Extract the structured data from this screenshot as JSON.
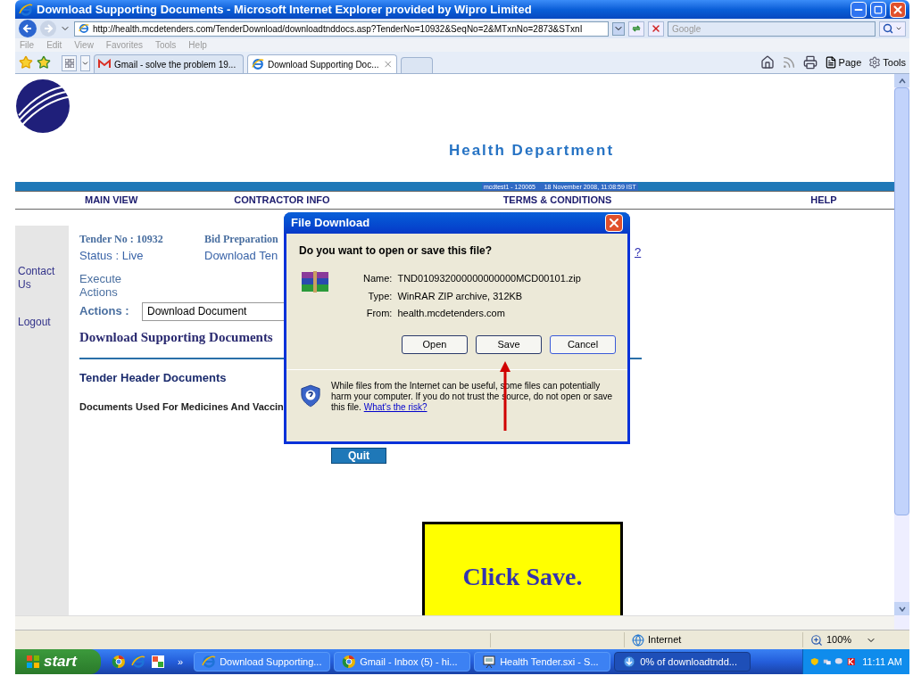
{
  "window": {
    "title": "Download Supporting Documents - Microsoft Internet Explorer provided by Wipro Limited"
  },
  "address_bar": {
    "url": "http://health.mcdetenders.com/TenderDownload/downloadtnddocs.asp?TenderNo=10932&SeqNo=2&MTxnNo=2873&STxnI",
    "search_placeholder": "Google"
  },
  "menu": [
    "File",
    "Edit",
    "View",
    "Favorites",
    "Tools",
    "Help"
  ],
  "tabs": [
    {
      "label": "Gmail - solve the problem 19...",
      "selected": false
    },
    {
      "label": "Download Supporting Doc...",
      "selected": true
    }
  ],
  "command_bar": [
    "Page",
    "Tools"
  ],
  "page": {
    "site_title": "Health Department",
    "session": "mcdtest1 - 120065",
    "timestamp": "18 November 2008,  11:08:59  IST",
    "nav": [
      "MAIN VIEW",
      "CONTRACTOR INFO",
      "TERMS & CONDITIONS",
      "HELP"
    ],
    "sidebar": [
      "Contact Us",
      "Logout"
    ],
    "tender_no": "Tender No : 10932",
    "status": "Status : Live",
    "bid_preparation": "Bid Preparation",
    "download_tender": "Download Ten",
    "link_fragment": "?",
    "execute_actions": "Execute Actions",
    "actions_label": "Actions :",
    "actions_value": "Download Document",
    "heading": "Download Supporting Documents",
    "section": "Tender Header Documents",
    "document": "Documents Used For Medicines And Vaccin",
    "quit": "Quit"
  },
  "dialog": {
    "title": "File Download",
    "question": "Do you want to open or save this file?",
    "fields": [
      {
        "label": "Name:",
        "value": "TND010932000000000000MCD00101.zip"
      },
      {
        "label": "Type:",
        "value": "WinRAR ZIP archive, 312KB"
      },
      {
        "label": "From:",
        "value": "health.mcdetenders.com"
      }
    ],
    "buttons": [
      "Open",
      "Save",
      "Cancel"
    ],
    "warning": "While files from the Internet can be useful, some files can potentially harm your computer. If you do not trust the source, do not open or save this file.",
    "risk_link": "What's the risk?"
  },
  "callout": "Click Save.",
  "status_bar": {
    "zone": "Internet",
    "zoom": "100%"
  },
  "taskbar": {
    "start": "start",
    "more": "»",
    "tasks": [
      {
        "label": "Download Supporting...",
        "kind": "ie",
        "selected": false
      },
      {
        "label": "Gmail - Inbox (5) - hi...",
        "kind": "chrome",
        "selected": false
      },
      {
        "label": "Health Tender.sxi - S...",
        "kind": "office",
        "selected": false
      },
      {
        "label": "0% of downloadtndd...",
        "kind": "download",
        "selected": true
      }
    ],
    "clock": "11:11 AM"
  }
}
